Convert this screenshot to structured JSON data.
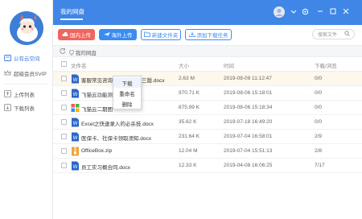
{
  "sidebar": {
    "items": [
      {
        "label": "公有云空间",
        "icon": "cloud-icon",
        "active": true
      },
      {
        "label": "超级会员SVIP",
        "icon": "crown-icon",
        "active": false
      },
      {
        "label": "上传列表",
        "icon": "upload-list-icon",
        "active": false
      },
      {
        "label": "下载列表",
        "icon": "download-list-icon",
        "active": false
      }
    ]
  },
  "header": {
    "title": "我的网盘",
    "controls": [
      "user-avatar",
      "minimize-icon",
      "settings-icon",
      "minimize-window-icon",
      "maximize-icon",
      "close-icon"
    ]
  },
  "toolbar": {
    "domestic_upload": "国内上传",
    "overseas_upload": "海外上传",
    "new_folder": "新建文件夹",
    "add_download": "添加下载任务",
    "search_placeholder": "搜索文件"
  },
  "breadcrumb": {
    "location": "我的网盘"
  },
  "table": {
    "columns": [
      "文件名",
      "大小",
      "时间",
      "下载/浏览"
    ],
    "rows": [
      {
        "name": "客服常见咨询问题汇总_第三版.docx",
        "size": "2.63 M",
        "time": "2019-08-09 11:12:47",
        "downloads": "0/0",
        "type": "word"
      },
      {
        "name": "飞猫云功能测",
        "size": "970.71 K",
        "time": "2019-08-06 15:18:01",
        "downloads": "0/0",
        "type": "word"
      },
      {
        "name": "飞猫云二期图",
        "size": "875.99 K",
        "time": "2019-08-06 15:18:34",
        "downloads": "0/0",
        "type": "image"
      },
      {
        "name": "Excel之快速录入的必杀技.docx",
        "size": "35.62 K",
        "time": "2019-07-18 16:49:20",
        "downloads": "0/0",
        "type": "word"
      },
      {
        "name": "医保卡、社保卡领取须知.docx",
        "size": "231.64 K",
        "time": "2019-07-04 16:58:01",
        "downloads": "2/9",
        "type": "word"
      },
      {
        "name": "OfficeBox.zip",
        "size": "12.04 M",
        "time": "2019-07-04 15:51:13",
        "downloads": "2/8",
        "type": "zip"
      },
      {
        "name": "员工实习概合同.docx",
        "size": "12.33 K",
        "time": "2019-04-08 16:06:25",
        "downloads": "7/17",
        "type": "word"
      }
    ]
  },
  "context_menu": {
    "items": [
      "下载",
      "重命名",
      "删除"
    ]
  },
  "colors": {
    "accent": "#3f86e6",
    "upload_pink": "#f2655f",
    "button_blue": "#3a8cf1",
    "hover_row": "#fdf7ec"
  }
}
